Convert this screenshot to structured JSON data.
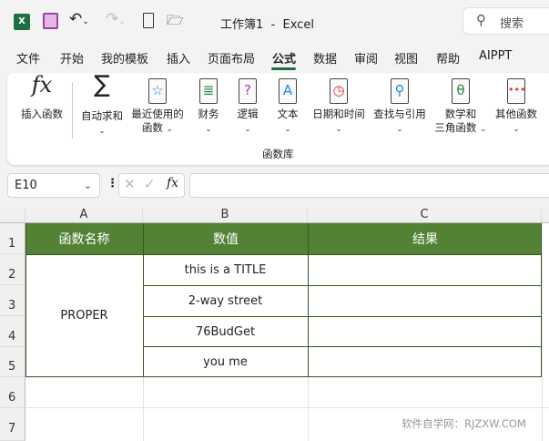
{
  "titlebar": {
    "title": "工作簿1  -  Excel",
    "search_placeholder": "搜索"
  },
  "tabs": [
    "文件",
    "开始",
    "我的模板",
    "插入",
    "页面布局",
    "公式",
    "数据",
    "审阅",
    "视图",
    "帮助",
    "AIPPT"
  ],
  "active_tab": "公式",
  "ribbon": {
    "items": [
      {
        "l1": "插入函数",
        "l2": ""
      },
      {
        "l1": "自动求和",
        "l2": ""
      },
      {
        "l1": "最近使用的",
        "l2": "函数"
      },
      {
        "l1": "财务",
        "l2": ""
      },
      {
        "l1": "逻辑",
        "l2": ""
      },
      {
        "l1": "文本",
        "l2": ""
      },
      {
        "l1": "日期和时间",
        "l2": ""
      },
      {
        "l1": "查找与引用",
        "l2": ""
      },
      {
        "l1": "数学和",
        "l2": "三角函数"
      },
      {
        "l1": "其他函数",
        "l2": ""
      }
    ],
    "group_label": "函数库"
  },
  "formula_bar": {
    "name_box": "E10",
    "fx": "fx",
    "formula": ""
  },
  "sheet": {
    "columns": [
      "A",
      "B",
      "C"
    ],
    "rows": [
      "1",
      "2",
      "3",
      "4",
      "5",
      "6",
      "7"
    ],
    "headers": [
      "函数名称",
      "数值",
      "结果"
    ],
    "function_name": "PROPER",
    "values": [
      "this is a TITLE",
      "2-way street",
      "76BudGet",
      "you me"
    ]
  },
  "watermark": "软件自学网：RJZXW.COM",
  "colors": {
    "header_green": "#548235",
    "border_green": "#375623"
  }
}
